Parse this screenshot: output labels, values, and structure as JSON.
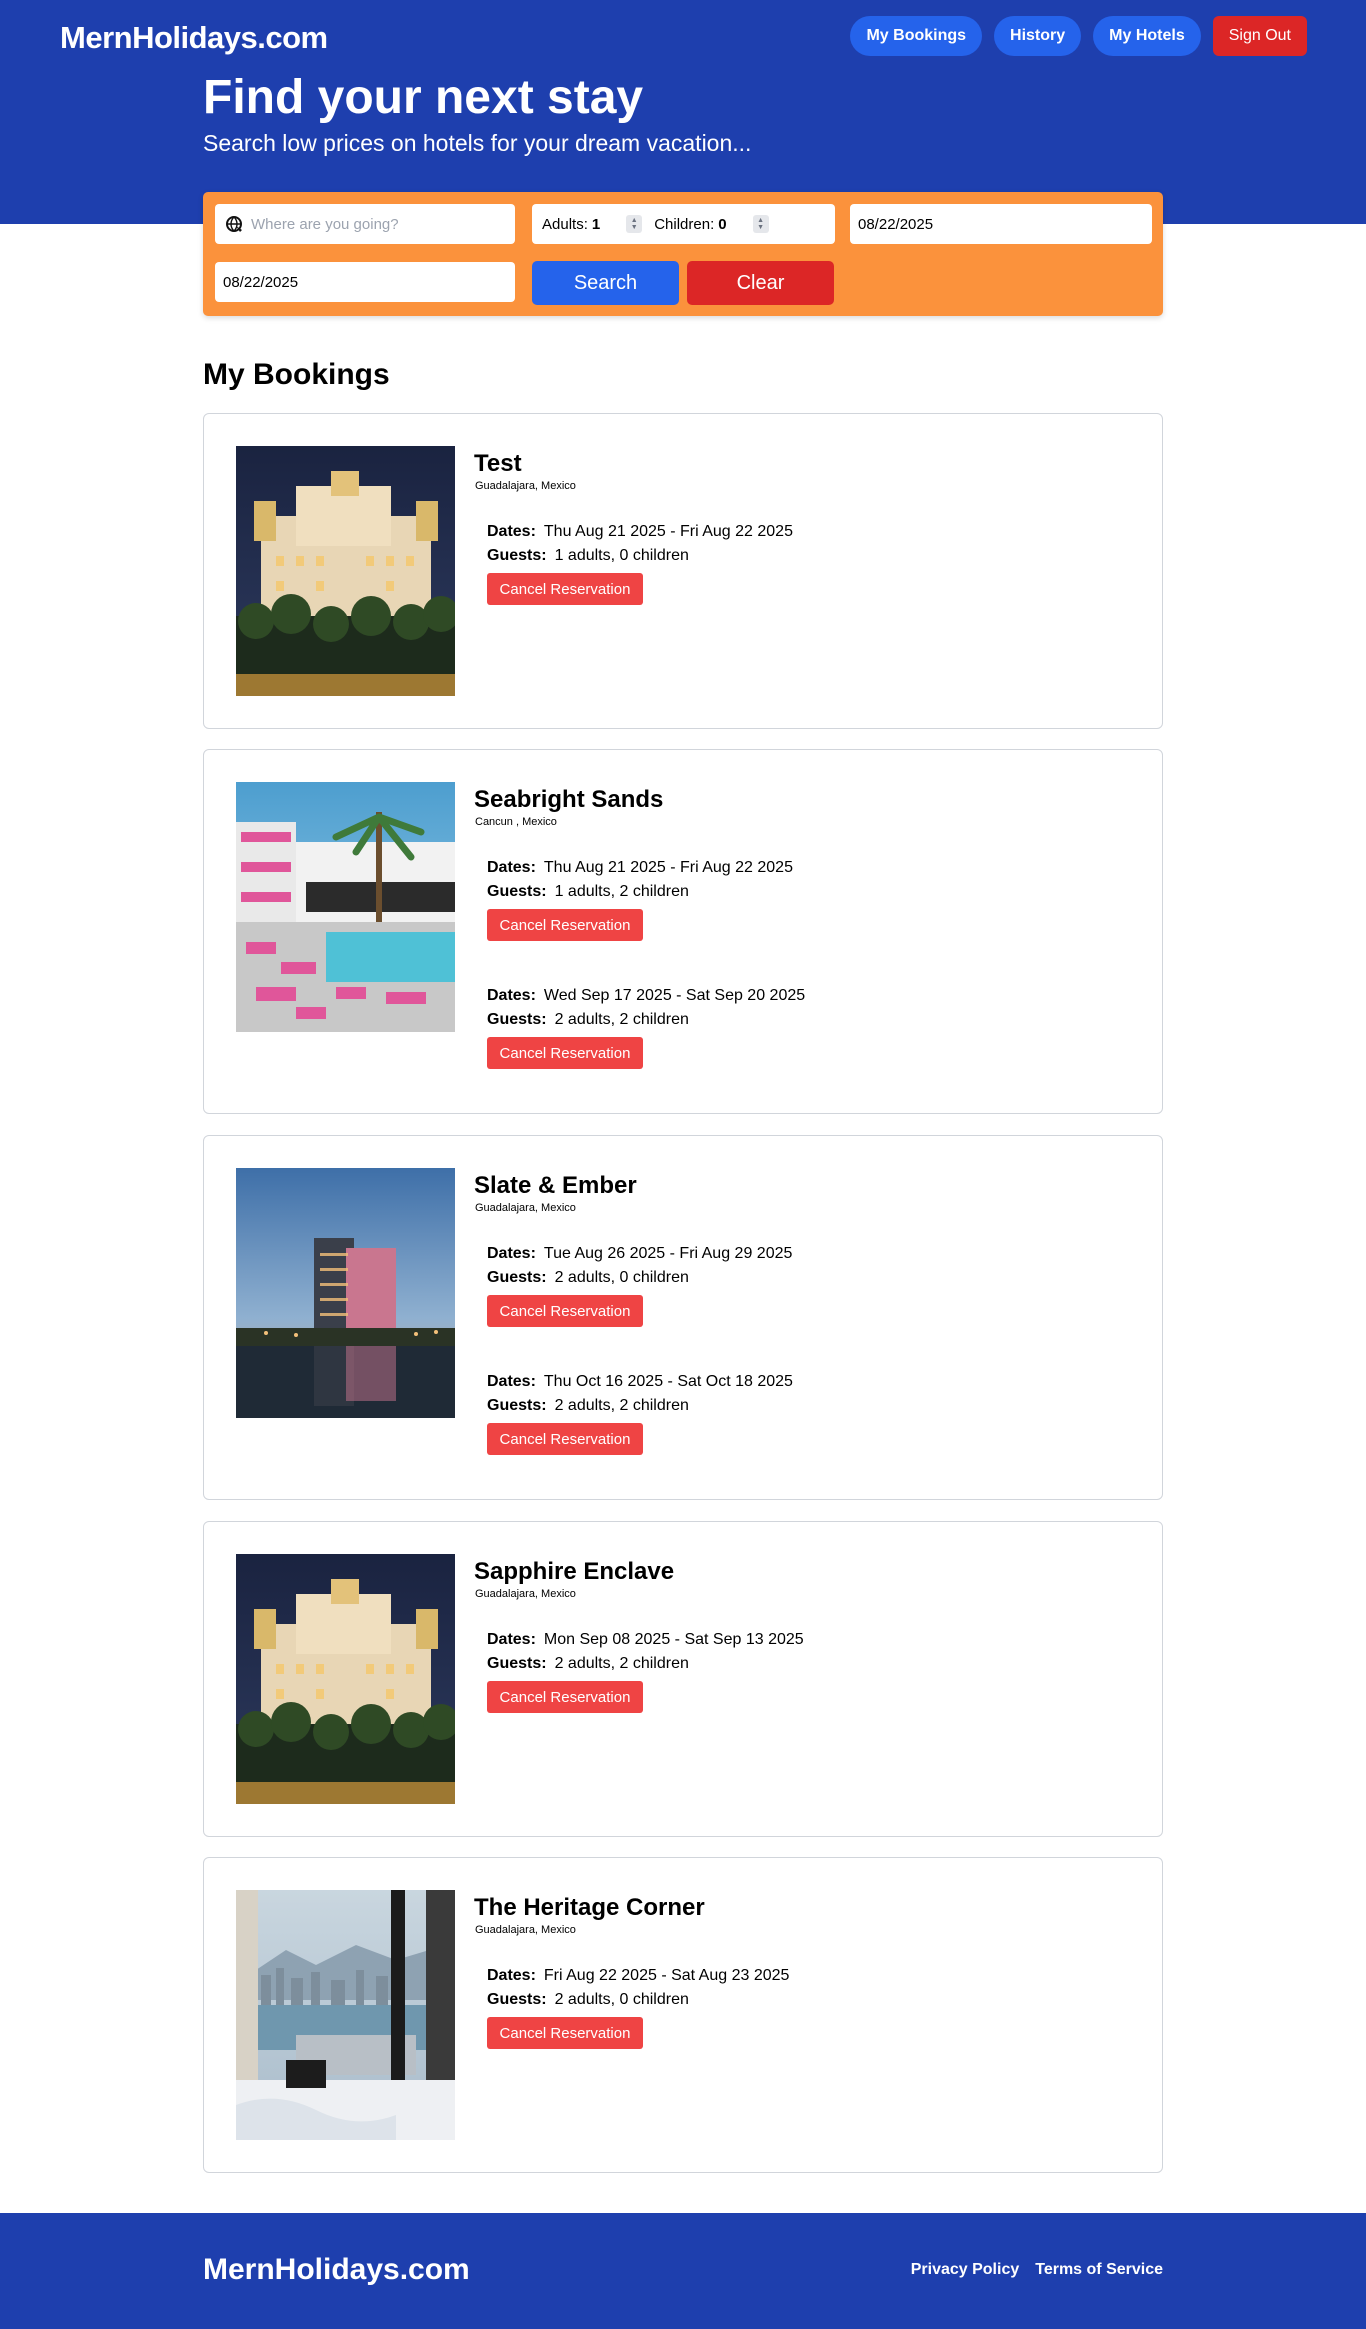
{
  "header": {
    "logo": "MernHolidays.com",
    "nav": [
      "My Bookings",
      "History",
      "My Hotels"
    ],
    "sign_out": "Sign Out",
    "hero_title": "Find your next stay",
    "hero_subtitle": "Search low prices on hotels for your dream vacation..."
  },
  "search": {
    "destination_placeholder": "Where are you going?",
    "adults_label": "Adults:",
    "adults_value": "1",
    "children_label": "Children:",
    "children_value": "0",
    "check_in": "08/22/2025",
    "check_out": "08/22/2025",
    "search_label": "Search",
    "clear_label": "Clear"
  },
  "bookings_title": "My Bookings",
  "labels": {
    "dates": "Dates:",
    "guests": "Guests:",
    "cancel": "Cancel Reservation"
  },
  "hotels": [
    {
      "name": "Test",
      "location": "Guadalajara, Mexico",
      "image": "palace-night",
      "bookings": [
        {
          "dates": "Thu Aug 21 2025 - Fri Aug 22 2025",
          "guests": "1 adults, 0 children"
        }
      ]
    },
    {
      "name": "Seabright Sands",
      "location": "Cancun , Mexico",
      "image": "pool-terrace",
      "bookings": [
        {
          "dates": "Thu Aug 21 2025 - Fri Aug 22 2025",
          "guests": "1 adults, 2 children"
        },
        {
          "dates": "Wed Sep 17 2025 - Sat Sep 20 2025",
          "guests": "2 adults, 2 children"
        }
      ]
    },
    {
      "name": "Slate & Ember",
      "location": "Guadalajara, Mexico",
      "image": "tower-lake",
      "bookings": [
        {
          "dates": "Tue Aug 26 2025 - Fri Aug 29 2025",
          "guests": "2 adults, 0 children"
        },
        {
          "dates": "Thu Oct 16 2025 - Sat Oct 18 2025",
          "guests": "2 adults, 2 children"
        }
      ]
    },
    {
      "name": "Sapphire Enclave",
      "location": "Guadalajara, Mexico",
      "image": "palace-night",
      "bookings": [
        {
          "dates": "Mon Sep 08 2025 - Sat Sep 13 2025",
          "guests": "2 adults, 2 children"
        }
      ]
    },
    {
      "name": "The Heritage Corner",
      "location": "Guadalajara, Mexico",
      "image": "room-harbor-view",
      "bookings": [
        {
          "dates": "Fri Aug 22 2025 - Sat Aug 23 2025",
          "guests": "2 adults, 0 children"
        }
      ]
    }
  ],
  "footer": {
    "logo": "MernHolidays.com",
    "links": [
      "Privacy Policy",
      "Terms of Service"
    ]
  },
  "colors": {
    "brand_blue": "#1e3fae",
    "button_blue": "#2563eb",
    "danger_red": "#dc2626",
    "cancel_red": "#ef4444",
    "search_orange": "#fb923c"
  }
}
